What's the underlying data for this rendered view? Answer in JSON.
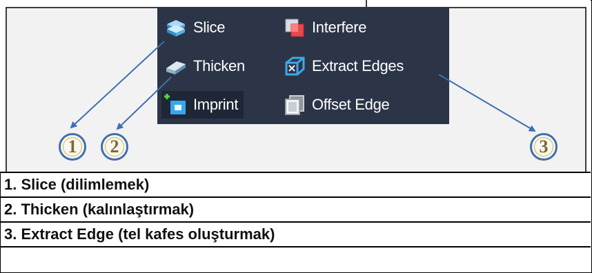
{
  "tools": [
    {
      "label": "Slice",
      "icon": "slice-icon"
    },
    {
      "label": "Interfere",
      "icon": "interfere-icon"
    },
    {
      "label": "Thicken",
      "icon": "thicken-icon"
    },
    {
      "label": "Extract Edges",
      "icon": "extract-edges-icon"
    },
    {
      "label": "Imprint",
      "icon": "imprint-icon"
    },
    {
      "label": "Offset Edge",
      "icon": "offset-edge-icon"
    }
  ],
  "callouts": [
    "1",
    "2",
    "3"
  ],
  "legend": [
    "1. Slice (dilimlemek)",
    "2. Thicken (kalınlaştırmak)",
    "3. Extract Edge (tel kafes oluşturmak)"
  ],
  "colors": {
    "panel": "#2b3547",
    "arrow": "#3d6fb0",
    "badge_ring": "#3d6fb0"
  }
}
